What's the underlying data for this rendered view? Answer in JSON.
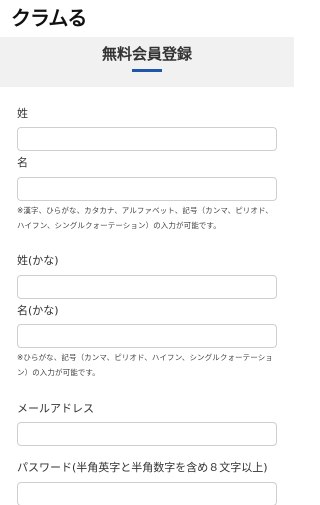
{
  "header": {
    "logo_text": "クラムる"
  },
  "form": {
    "title": "無料会員登録",
    "last_name": {
      "label": "姓",
      "value": ""
    },
    "first_name": {
      "label": "名",
      "value": ""
    },
    "name_note": "※漢字、ひらがな、カタカナ、アルファベット、記号（カンマ、ピリオド、ハイフン、シングルクォーテーション）の入力が可能です。",
    "last_name_kana": {
      "label": "姓(かな)",
      "value": ""
    },
    "first_name_kana": {
      "label": "名(かな)",
      "value": ""
    },
    "kana_note": "※ひらがな、記号（カンマ、ピリオド、ハイフン、シングルクォーテーション）の入力が可能です。",
    "email": {
      "label": "メールアドレス",
      "value": ""
    },
    "password": {
      "label": "パスワード(半角英字と半角数字を含め８文字以上)",
      "value": ""
    }
  },
  "colors": {
    "accent": "#1f56a7",
    "title_band": "#f1f1f1",
    "field_border": "#cfcfcf"
  }
}
